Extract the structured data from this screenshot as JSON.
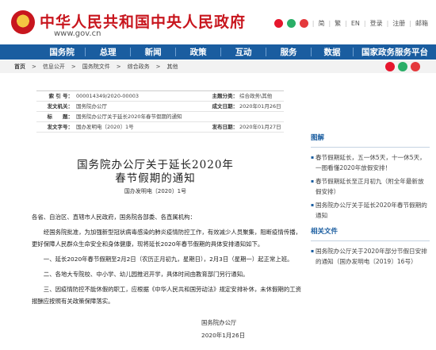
{
  "header": {
    "title": "中华人民共和国中央人民政府",
    "url": "www.gov.cn",
    "links": [
      "简",
      "繁",
      "EN",
      "登录",
      "注册",
      "邮箱"
    ]
  },
  "nav": [
    "国务院",
    "总理",
    "新闻",
    "政策",
    "互动",
    "服务",
    "数据",
    "国家政务服务平台"
  ],
  "breadcrumb": [
    "首页",
    "信息公开",
    "国务院文件",
    "综合政务",
    "其他"
  ],
  "info": {
    "index_key": "索 引 号：",
    "index_val": "000014349/2020-00003",
    "topic_key": "主题分类：",
    "topic_val": "综合政务\\其他",
    "issuer_key": "发文机关：",
    "issuer_val": "国务院办公厅",
    "date_key": "成文日期：",
    "date_val": "2020年01月26日",
    "title_key": "标　　题：",
    "title_val": "国务院办公厅关于延长2020年春节假期的通知",
    "num_key": "发文字号：",
    "num_val": "国办发明电〔2020〕1号",
    "pub_key": "发布日期：",
    "pub_val": "2020年01月27日"
  },
  "article": {
    "title_line1": "国务院办公厅关于延长2020年",
    "title_line2": "春节假期的通知",
    "doc_no": "国办发明电〔2020〕1号",
    "recipients": "各省、自治区、直辖市人民政府，国务院各部委、各直属机构：",
    "p1": "经国务院批准，为加强新型冠状病毒感染的肺炎疫情防控工作，有效减少人员聚集，阻断疫情传播，更好保障人民群众生命安全和身体健康，现将延长2020年春节假期的具体安排通知如下。",
    "p2": "一、延长2020年春节假期至2月2日（农历正月初九，星期日），2月3日（星期一）起正常上班。",
    "p3": "二、各地大专院校、中小学、幼儿园推迟开学，具体时间由教育部门另行通知。",
    "p4": "三、因疫情防控不能休假的职工，应根据《中华人民共和国劳动法》规定安排补休，未休假期的工资报酬应按照有关政策保障落实。",
    "sign_org": "国务院办公厅",
    "sign_date": "2020年1月26日"
  },
  "sidebar": {
    "section1_title": "图解",
    "section1_items": [
      "春节假期延长，五一休5天，十一休5天，一图看懂2020年放假安排！",
      "春节假期延长至正月初九（附全年最新放假安排）",
      "国务院办公厅关于延长2020年春节假期的通知"
    ],
    "section2_title": "相关文件",
    "section2_items": [
      "国务院办公厅关于2020年部分节假日安排的通知（国办发明电〔2019〕16号）"
    ]
  },
  "colors": {
    "brand_red": "#c8161e",
    "nav_blue": "#1a5da0"
  }
}
